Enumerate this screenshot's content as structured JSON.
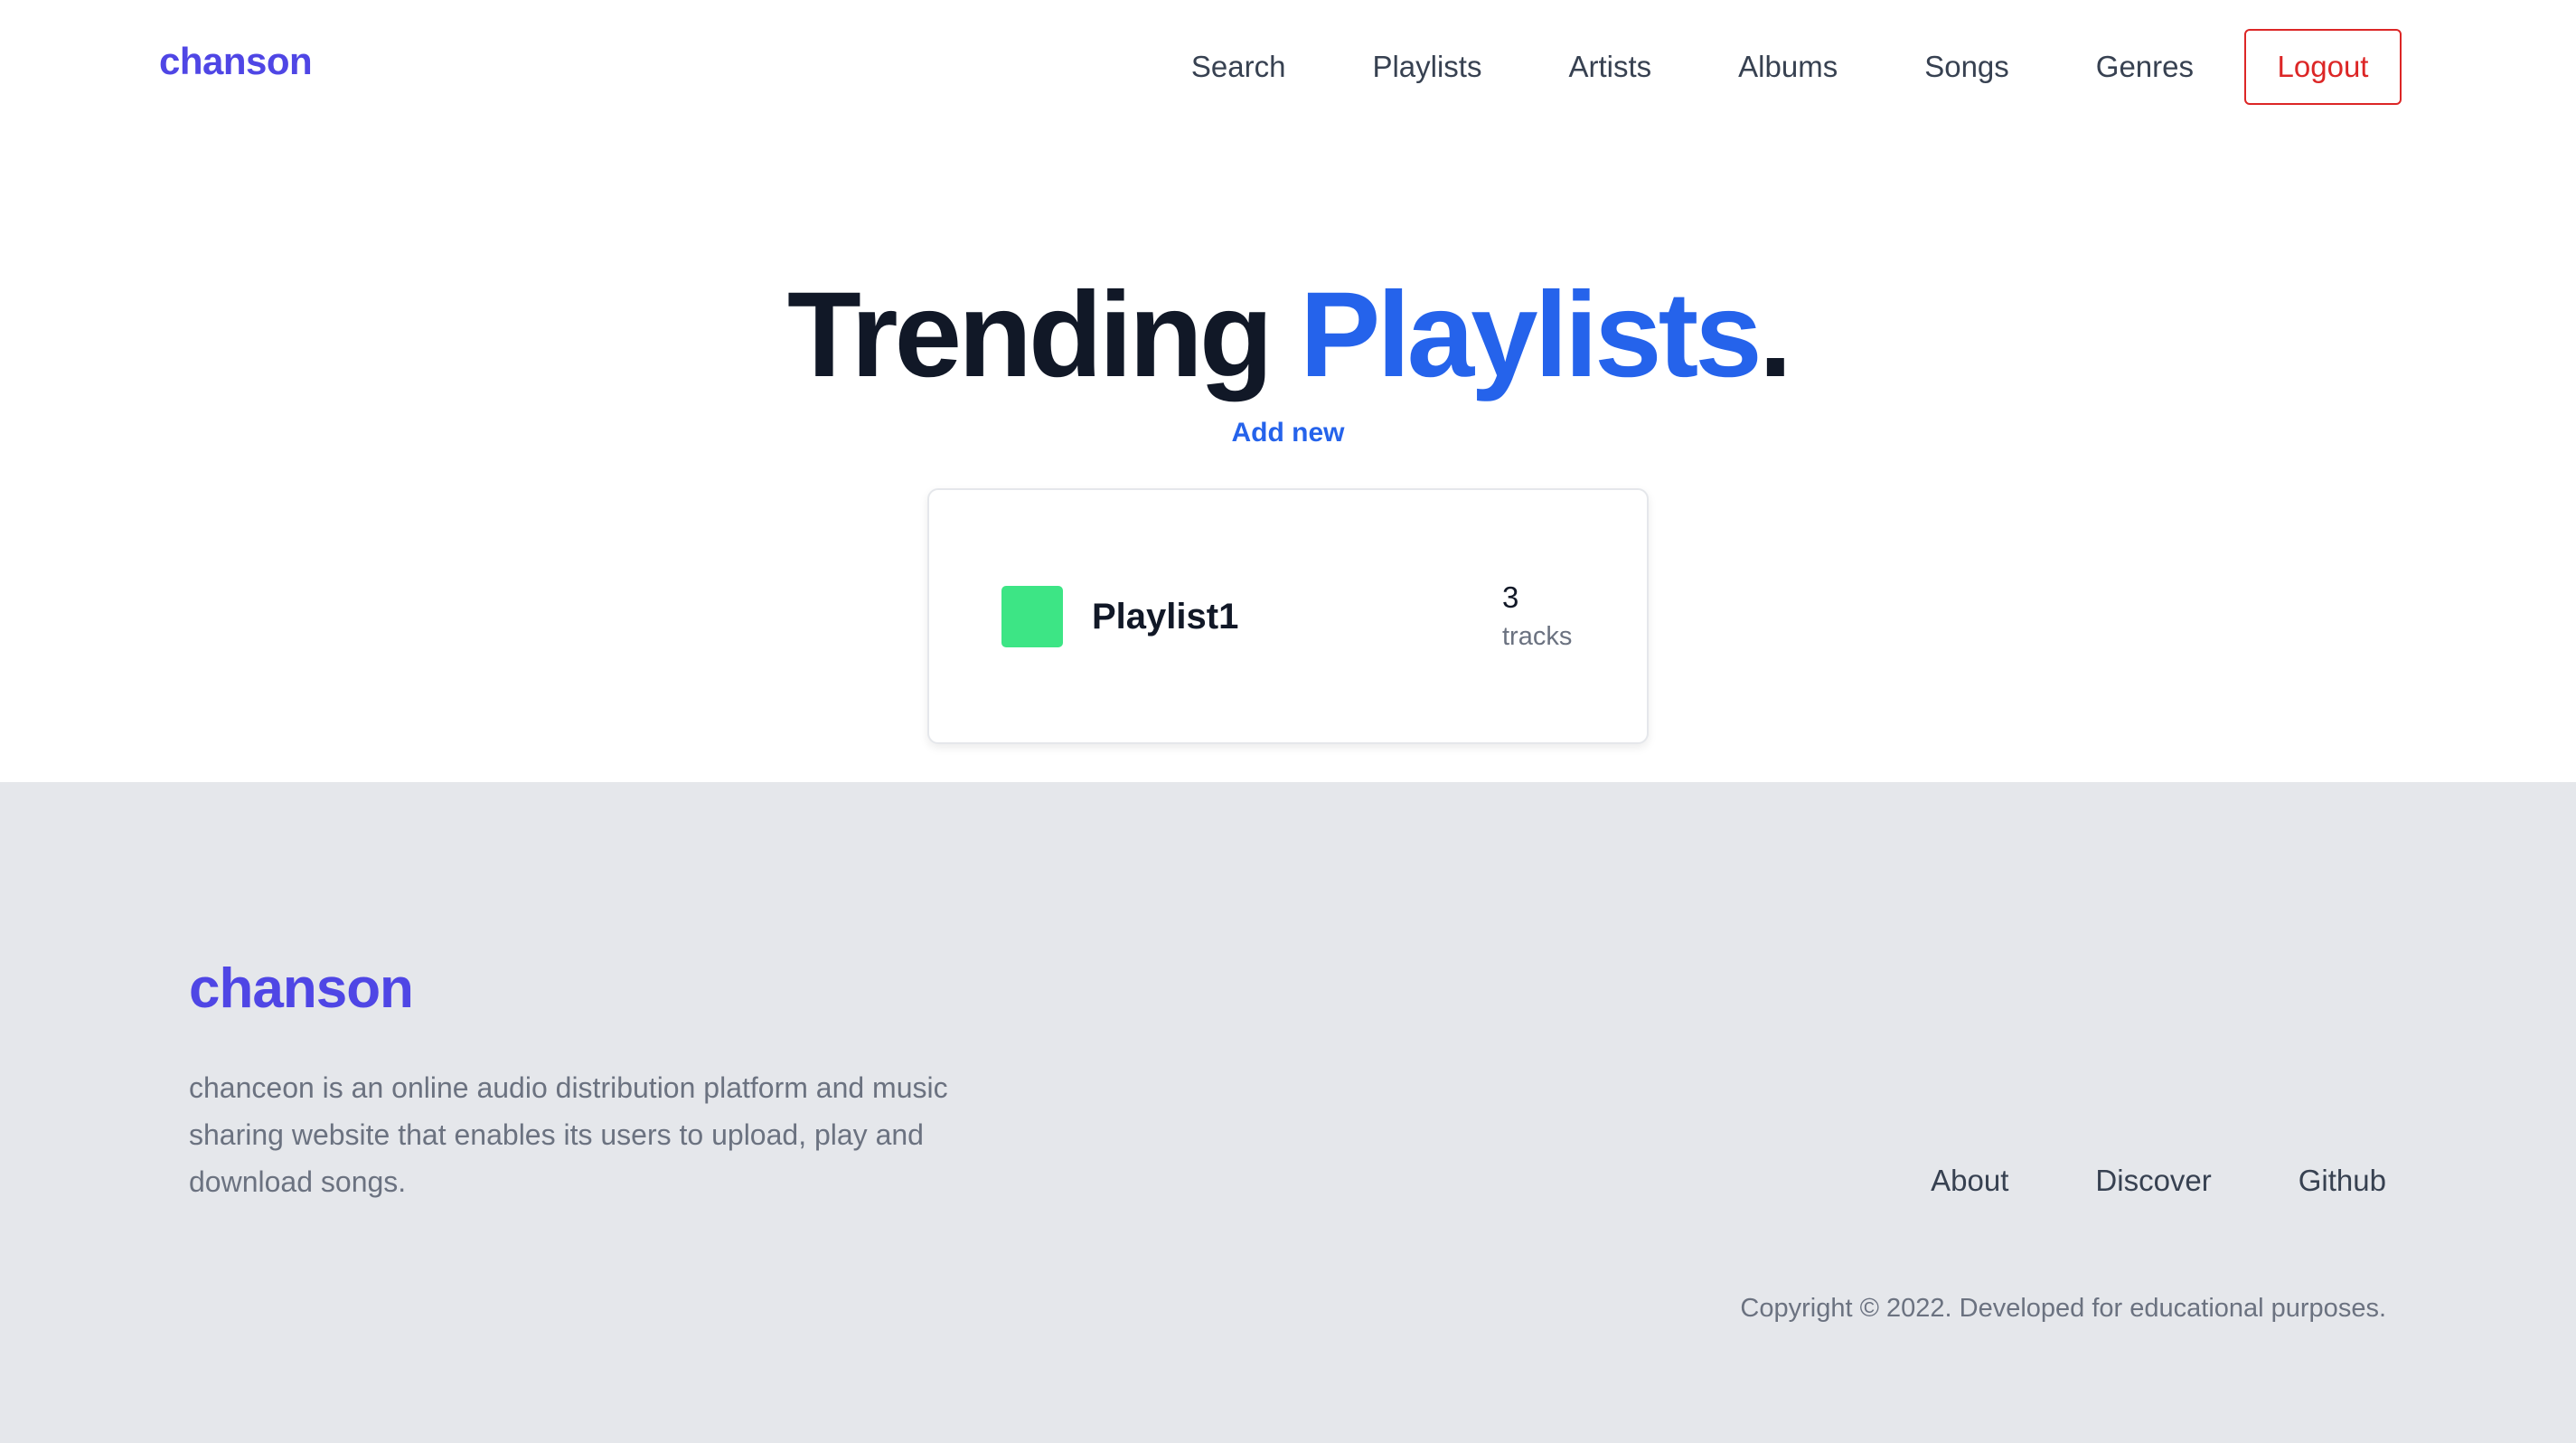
{
  "header": {
    "brand": "chanson",
    "nav": [
      "Search",
      "Playlists",
      "Artists",
      "Albums",
      "Songs",
      "Genres"
    ],
    "logout_label": "Logout"
  },
  "hero": {
    "title_main": "Trending",
    "title_accent": "Playlists",
    "title_end": ".",
    "add_new_label": "Add new"
  },
  "playlists": [
    {
      "name": "Playlist1",
      "track_count": "3",
      "track_unit": "tracks",
      "color": "#3de585"
    }
  ],
  "footer": {
    "brand": "chanson",
    "description": "chanceon is an online audio distribution platform and music sharing website that enables its users to upload, play and download songs.",
    "links": [
      "About",
      "Discover",
      "Github"
    ],
    "copyright": "Copyright © 2022. Developed for educational purposes."
  },
  "colors": {
    "brand": "#4f46e5",
    "accent": "#2563eb",
    "danger": "#dc2626",
    "footer_bg": "#e5e7eb"
  }
}
